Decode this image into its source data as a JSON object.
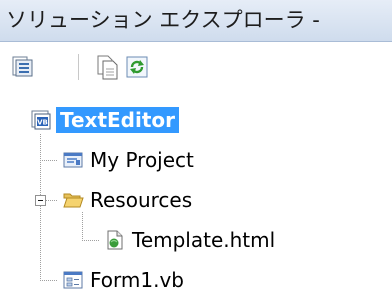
{
  "window": {
    "title": "ソリューション エクスプローラ -"
  },
  "toolbar": {
    "buttons": [
      {
        "icon": "properties-icon"
      },
      {
        "icon": "show-all-files-icon"
      },
      {
        "icon": "refresh-icon"
      }
    ]
  },
  "tree": {
    "root": {
      "label": "TextEditor",
      "icon": "vb-project-icon",
      "selected": true
    },
    "items": [
      {
        "label": "My Project",
        "icon": "my-project-icon"
      },
      {
        "label": "Resources",
        "icon": "folder-open-icon",
        "expanded": true
      },
      {
        "label": "Template.html",
        "icon": "html-file-icon"
      },
      {
        "label": "Form1.vb",
        "icon": "form-icon"
      }
    ]
  },
  "colors": {
    "selection": "#3399ff",
    "title_bar": "#cfdced"
  }
}
